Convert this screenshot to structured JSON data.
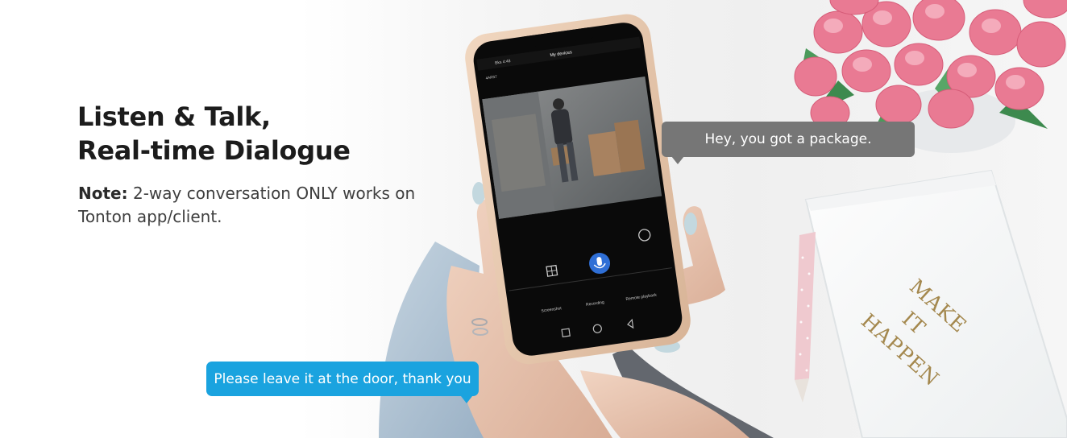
{
  "headline": {
    "line1": "Listen & Talk,",
    "line2": "Real-time Dialogue"
  },
  "note": {
    "label": "Note:",
    "text": "2-way conversation ONLY works on Tonton app/client."
  },
  "bubbles": {
    "incoming": "Hey, you got a package.",
    "outgoing": "Please leave it at the door, thank you"
  },
  "notebook": {
    "line1": "MAKE",
    "line2": "IT",
    "line3": "HAPPEN"
  },
  "phone": {
    "app_title": "My devices",
    "status_time": "10:08",
    "status_carrier": "Bks 4:48",
    "device_label": "4ARS7",
    "actions": [
      {
        "label": "Screenshot",
        "icon": "crop-icon"
      },
      {
        "label": "Recording",
        "icon": "video-icon"
      },
      {
        "label": "Remote playback",
        "icon": "history-icon"
      }
    ]
  },
  "colors": {
    "bubble_gray": "#767676",
    "bubble_blue": "#1aa3df",
    "mic_button": "#2f6fd6",
    "gold_text": "#a4884e"
  }
}
